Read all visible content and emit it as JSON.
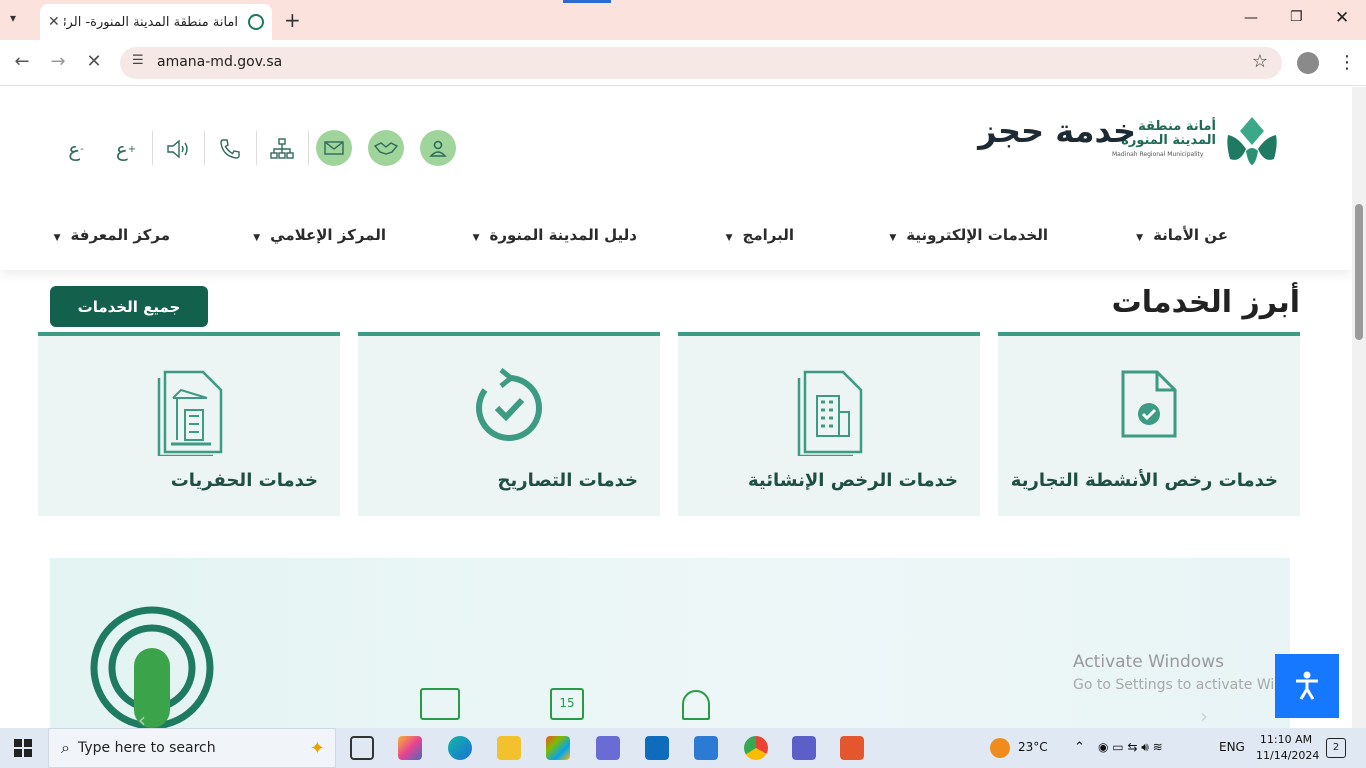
{
  "browser": {
    "tab_title": "امانة منطقة المدينة المنورة- الرئيسية",
    "url": "amana-md.gov.sa"
  },
  "header": {
    "logo_line1": "أمانة منطقة",
    "logo_line2": "المدينة المنورة",
    "logo_english": "Madinah Regional Municipality",
    "font_decrease": "ع",
    "font_increase": "ع",
    "font_decrease_sign": "-",
    "font_increase_sign": "+"
  },
  "menu": [
    {
      "label": "عن الأمانة"
    },
    {
      "label": "الخدمات الإلكترونية"
    },
    {
      "label": "البرامج"
    },
    {
      "label": "دليل المدينة المنورة"
    },
    {
      "label": "المركز الإعلامي"
    },
    {
      "label": "مركز المعرفة"
    }
  ],
  "section": {
    "title": "أبرز الخدمات",
    "all_button": "جميع الخدمات"
  },
  "cards": [
    {
      "label": "خدمات رخص الأنشطة التجارية",
      "icon": "document-check-icon"
    },
    {
      "label": "خدمات الرخص الإنشائية",
      "icon": "building-document-icon"
    },
    {
      "label": "خدمات التصاريح",
      "icon": "refresh-check-icon"
    },
    {
      "label": "خدمات الحفريات",
      "icon": "crane-document-icon"
    }
  ],
  "banner": {
    "title": "خدمة حجز"
  },
  "watermark": {
    "line1": "Activate Windows",
    "line2": "Go to Settings to activate Windows."
  },
  "taskbar": {
    "search_placeholder": "Type here to search",
    "weather": "23°C",
    "lang": "ENG",
    "time": "11:10 AM",
    "date": "11/14/2024",
    "notifications": "2"
  },
  "colors": {
    "brand": "#13604d",
    "accent": "#3d9a83",
    "card_bg": "#edf4f4",
    "icon_circle": "#9fd49a",
    "a11y": "#1677ff"
  }
}
